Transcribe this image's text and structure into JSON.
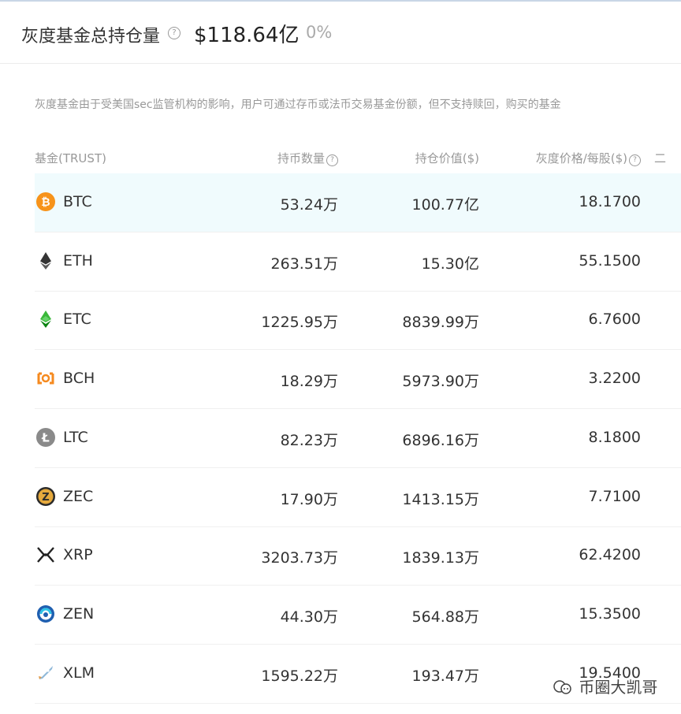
{
  "header": {
    "title": "灰度基金总持仓量",
    "help_icon": "question-circle-icon",
    "total_value": "$118.64亿",
    "change": "0%"
  },
  "notice": "灰度基金由于受美国sec监管机构的影响，用户可通过存币或法币交易基金份额，但不支持赎回，购买的基金",
  "table": {
    "columns": [
      "基金(TRUST)",
      "持币数量",
      "持仓价值($)",
      "灰度价格/每股($)",
      "二"
    ],
    "rows": [
      {
        "symbol": "BTC",
        "icon": "btc-icon",
        "holdings": "53.24万",
        "value": "100.77亿",
        "price": "18.1700"
      },
      {
        "symbol": "ETH",
        "icon": "eth-icon",
        "holdings": "263.51万",
        "value": "15.30亿",
        "price": "55.1500"
      },
      {
        "symbol": "ETC",
        "icon": "etc-icon",
        "holdings": "1225.95万",
        "value": "8839.99万",
        "price": "6.7600"
      },
      {
        "symbol": "BCH",
        "icon": "bch-icon",
        "holdings": "18.29万",
        "value": "5973.90万",
        "price": "3.2200"
      },
      {
        "symbol": "LTC",
        "icon": "ltc-icon",
        "holdings": "82.23万",
        "value": "6896.16万",
        "price": "8.1800"
      },
      {
        "symbol": "ZEC",
        "icon": "zec-icon",
        "holdings": "17.90万",
        "value": "1413.15万",
        "price": "7.7100"
      },
      {
        "symbol": "XRP",
        "icon": "xrp-icon",
        "holdings": "3203.73万",
        "value": "1839.13万",
        "price": "62.4200"
      },
      {
        "symbol": "ZEN",
        "icon": "zen-icon",
        "holdings": "44.30万",
        "value": "564.88万",
        "price": "15.3500"
      },
      {
        "symbol": "XLM",
        "icon": "xlm-icon",
        "holdings": "1595.22万",
        "value": "193.47万",
        "price": "19.5400"
      }
    ]
  },
  "watermark": "币圈大凯哥",
  "colors": {
    "highlight_row": "#f0fbfd",
    "btc": "#f7931a",
    "etc": "#3ab83a",
    "bch": "#f58a1f",
    "ltc": "#8a8a8a",
    "zec": "#e5a93d",
    "zen": "#1f5fb0"
  }
}
